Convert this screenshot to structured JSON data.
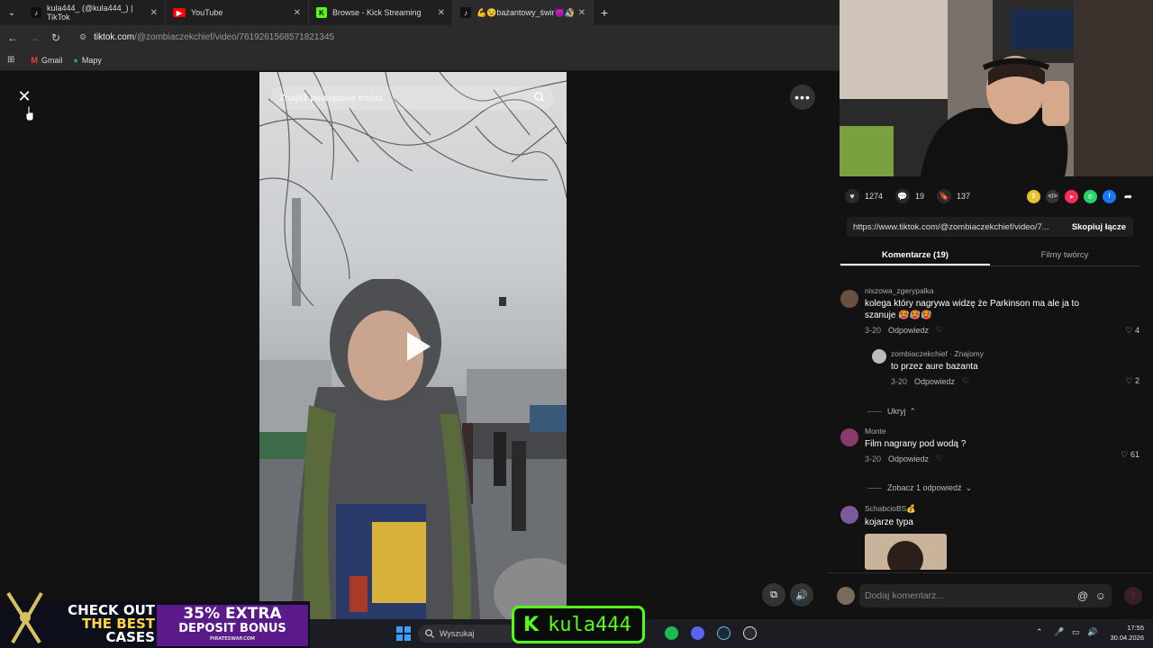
{
  "browser": {
    "tabs": [
      {
        "label": "kula444_ (@kula444_) | TikTok",
        "icon": "tiktok-icon"
      },
      {
        "label": "YouTube",
        "icon": "youtube-icon"
      },
      {
        "label": "Browse - Kick Streaming",
        "icon": "kick-icon"
      },
      {
        "label": "💪😉bażantowy_świr👿👍",
        "icon": "tiktok-icon",
        "active": true
      }
    ],
    "url_host": "tiktok.com",
    "url_path": "/@zombiaczekchief/video/7619261568571821345",
    "bookmarks": [
      "Gmail",
      "Mapy"
    ]
  },
  "player": {
    "search_placeholder": "Znajdź powiązane treści"
  },
  "stats": {
    "likes": "1274",
    "comments": "19",
    "saves": "137"
  },
  "share": {
    "link": "https://www.tiktok.com/@zombiaczekchief/video/7...",
    "copy_label": "Skopiuj łącze"
  },
  "tabs": {
    "comments": "Komentarze (19)",
    "creator_videos": "Filmy twórcy"
  },
  "comments": [
    {
      "user": "niszowa_zgerypalka",
      "text": "kolega który nagrywa widzę że Parkinson ma ale ja to szanuje 🥵🥵🥵",
      "date": "3-20",
      "reply_label": "Odpowiedz",
      "likes": "4"
    },
    {
      "user": "zombiaczekchief",
      "badge": "Znajomy",
      "text": "to przez aure bazanta",
      "date": "3-20",
      "reply_label": "Odpowiedz",
      "likes": "2"
    },
    {
      "user": "Monte",
      "text": "Film nagrany pod wodą ?",
      "date": "3-20",
      "reply_label": "Odpowiedz",
      "likes": "61"
    },
    {
      "user": "SchabcioBS💰",
      "text": "kojarze typa"
    }
  ],
  "thread": {
    "hide_label": "Ukryj",
    "show_reply_label": "Zobacz 1 odpowiedź"
  },
  "add_comment_placeholder": "Dodaj komentarz...",
  "overlay": {
    "promo_line1": "CHECK OUT",
    "promo_line2": "THE BEST",
    "promo_line3": "CASES",
    "promo_bonus1": "35% EXTRA",
    "promo_bonus2": "DEPOSIT BONUS",
    "promo_site": "PIRATESWAP.COM",
    "kick_name": "kula444"
  },
  "taskbar": {
    "search_label": "Wyszukaj",
    "time": "17:55",
    "date": "30.04.2026"
  }
}
